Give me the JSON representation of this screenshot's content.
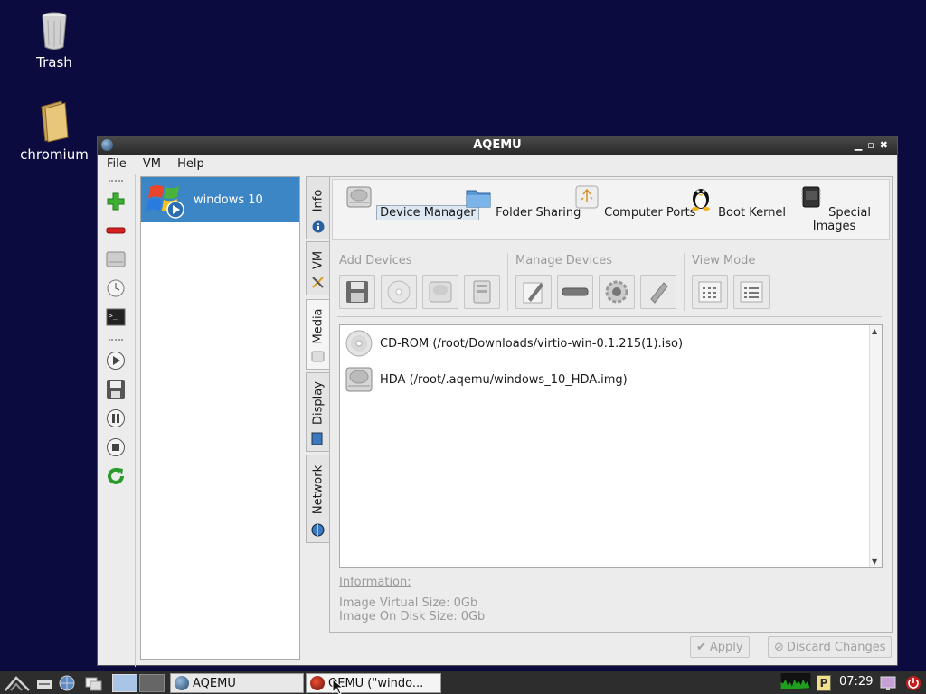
{
  "desktop": {
    "icons": [
      {
        "label": "Trash"
      },
      {
        "label": "chromium"
      }
    ]
  },
  "window": {
    "title": "AQEMU",
    "menu": [
      "File",
      "VM",
      "Help"
    ],
    "vm_list": [
      {
        "name": "windows 10"
      }
    ],
    "vertical_tabs": [
      "Info",
      "VM",
      "Media",
      "Display",
      "Network"
    ],
    "top_sections": [
      "Device Manager",
      "Folder Sharing",
      "Computer Ports",
      "Boot Kernel",
      "Special Images"
    ],
    "groups": {
      "add": "Add Devices",
      "manage": "Manage Devices",
      "view": "View Mode"
    },
    "devices": [
      {
        "label": "CD-ROM (/root/Downloads/virtio-win-0.1.215(1).iso)",
        "icon": "cdrom-icon"
      },
      {
        "label": "HDA (/root/.aqemu/windows_10_HDA.img)",
        "icon": "harddisk-icon"
      }
    ],
    "information": {
      "label": "Information:",
      "virtual_size": "Image Virtual Size: 0Gb",
      "disk_size": "Image On Disk Size: 0Gb"
    },
    "buttons": {
      "apply": "Apply",
      "discard": "Discard Changes"
    }
  },
  "taskbar": {
    "tasks": [
      "AQEMU",
      "QEMU (\"windo..."
    ],
    "clock": "07:29"
  },
  "colors": {
    "desktop_bg": "#0b0b3f",
    "selection": "#3d86c6"
  }
}
